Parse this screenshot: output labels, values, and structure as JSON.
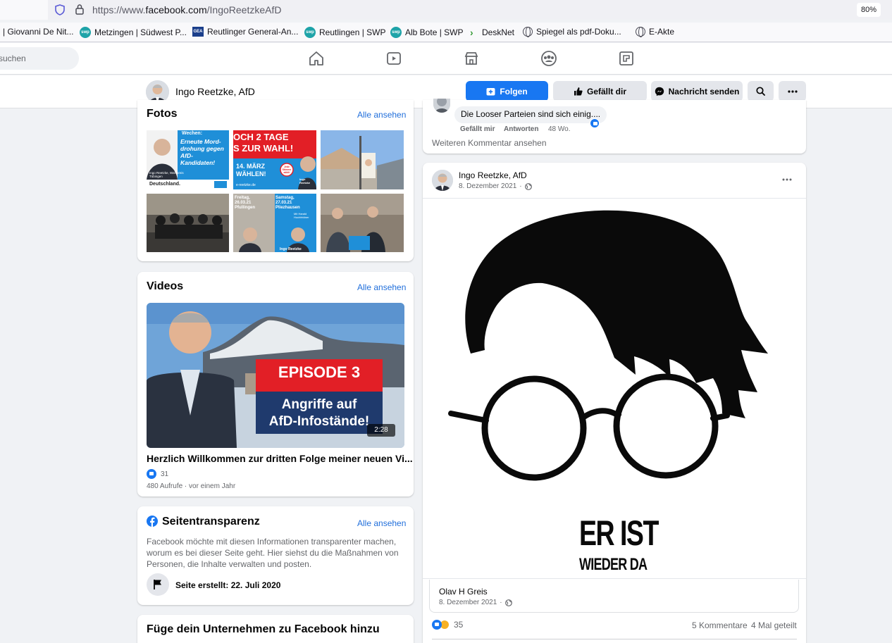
{
  "browser": {
    "url_prefix": "https://www.",
    "url_domain": "facebook.com",
    "url_path": "/IngoReetzkeAfD",
    "zoom": "80%",
    "bookmarks": [
      "| Giovanni De Nit...",
      "Metzingen | Südwest P...",
      "Reutlinger General-An...",
      "Reutlingen | SWP",
      "Alb Bote | SWP",
      "DeskNet",
      "Spiegel als pdf-Doku...",
      "E-Akte"
    ],
    "bookmark_badges": {
      "swp": "swp",
      "gea": "GEA"
    }
  },
  "fbnav": {
    "search_placeholder": "suchen"
  },
  "page": {
    "name": "Ingo Reetzke, AfD",
    "follow_label": "Folgen",
    "like_label": "Gefällt dir",
    "message_label": "Nachricht senden"
  },
  "photos": {
    "title": "Fotos",
    "see_all": "Alle ansehen",
    "p1": {
      "lead": "Wechen:",
      "headline": "Erneute Mord-drohung gegen AfD-Kandidaten!",
      "name": "Ingo Reetzke, Wahlkreis Tübingen",
      "footer": "Deutschland."
    },
    "p2": {
      "line1": "OCH 2 TAGE",
      "line2": "S ZUR WAHL!",
      "line3": "14. MÄRZ",
      "line4": "WÄHLEN!",
      "badge": "Jede Stimme zählt!",
      "url": "e-reetzke.de",
      "name": "Ingo Reetzke"
    },
    "p5": {
      "left": "Freitag, 26.03.21 Pfullingen",
      "right": "Samstag, 27.03.21 Pliezhausen",
      "caption": "Mit Harald Hochfeldner",
      "footer": "Ingo Reetzke"
    }
  },
  "videos": {
    "title": "Videos",
    "see_all": "Alle ansehen",
    "episode": "EPISODE 3",
    "overlay_line1": "Angriffe auf",
    "overlay_line2": "AfD-Infostände!",
    "duration": "2:28",
    "caption": "Herzlich Willkommen zur dritten Folge meiner neuen Vi...",
    "likes": "31",
    "meta": "480 Aufrufe · vor einem Jahr"
  },
  "transparency": {
    "title": "Seitentransparenz",
    "see_all": "Alle ansehen",
    "text": "Facebook möchte mit diesen Informationen transparenter machen, worum es bei dieser Seite geht. Hier siehst du die Maßnahmen von Personen, die Inhalte verwalten und posten.",
    "created": "Seite erstellt: 22. Juli 2020"
  },
  "business": {
    "title": "Füge dein Unternehmen zu Facebook hinzu"
  },
  "comment": {
    "text": "Die Looser Parteien sind sich einig....",
    "like": "Gefällt mir",
    "reply": "Antworten",
    "age": "48 Wo.",
    "more": "Weiteren Kommentar ansehen"
  },
  "post": {
    "author": "Ingo Reetzke, AfD",
    "date": "8. Dezember 2021",
    "image_text_line1": "ER IST",
    "image_text_line2": "WIEDER DA",
    "shared_author": "Olav H Greis",
    "shared_date": "8. Dezember 2021",
    "reactions": "35",
    "comments": "5 Kommentare",
    "shares": "4 Mal geteilt"
  },
  "colors": {
    "fb_blue": "#1877f2",
    "link_blue": "#216fdb",
    "bg": "#f0f2f5"
  }
}
